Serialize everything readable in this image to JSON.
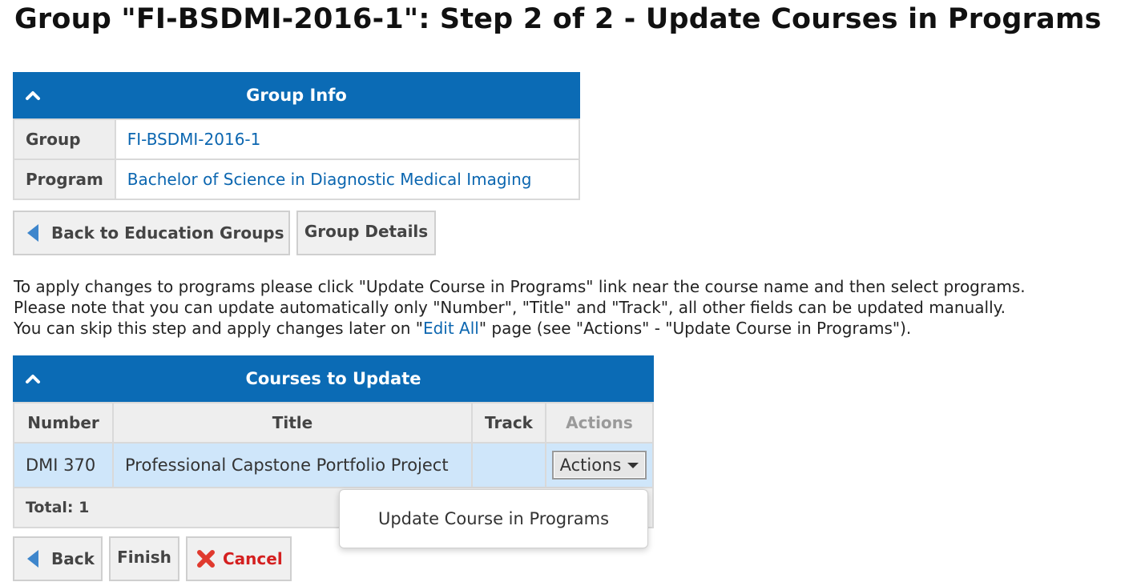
{
  "page": {
    "title": "Group \"FI-BSDMI-2016-1\": Step 2 of 2 - Update Courses in Programs"
  },
  "group_info": {
    "header": "Group Info",
    "rows": [
      {
        "label": "Group",
        "value": "FI-BSDMI-2016-1"
      },
      {
        "label": "Program",
        "value": "Bachelor of Science in Diagnostic Medical Imaging"
      }
    ]
  },
  "nav_buttons": {
    "back_to_groups": "Back to Education Groups",
    "group_details": "Group Details"
  },
  "intro": {
    "line1": "To apply changes to programs please click \"Update Course in Programs\" link near the course name and then select programs.",
    "line2": "Please note that you can update automatically only \"Number\", \"Title\" and \"Track\", all other fields can be updated manually.",
    "line3_before": "You can skip this step and apply changes later on \"",
    "line3_link": "Edit All",
    "line3_after": "\" page (see \"Actions\" - \"Update Course in Programs\")."
  },
  "courses": {
    "header": "Courses to Update",
    "columns": [
      "Number",
      "Title",
      "Track",
      "Actions"
    ],
    "rows": [
      {
        "number": "DMI 370",
        "title": "Professional Capstone Portfolio Project",
        "track": "",
        "actions_label": "Actions"
      }
    ],
    "total_label": "Total: 1"
  },
  "actions_menu": {
    "items": [
      "Update Course in Programs"
    ]
  },
  "footer_buttons": {
    "back": "Back",
    "finish": "Finish",
    "cancel": "Cancel"
  },
  "colors": {
    "header_blue": "#0b6bb5",
    "link_blue": "#0b66b0",
    "selected_row": "#cfe6fa",
    "cancel_red": "#d42020"
  },
  "icons": {
    "collapse": "chevron-up-icon",
    "back": "triangle-left-icon",
    "cancel": "red-x-icon",
    "dropdown": "caret-down-icon"
  }
}
